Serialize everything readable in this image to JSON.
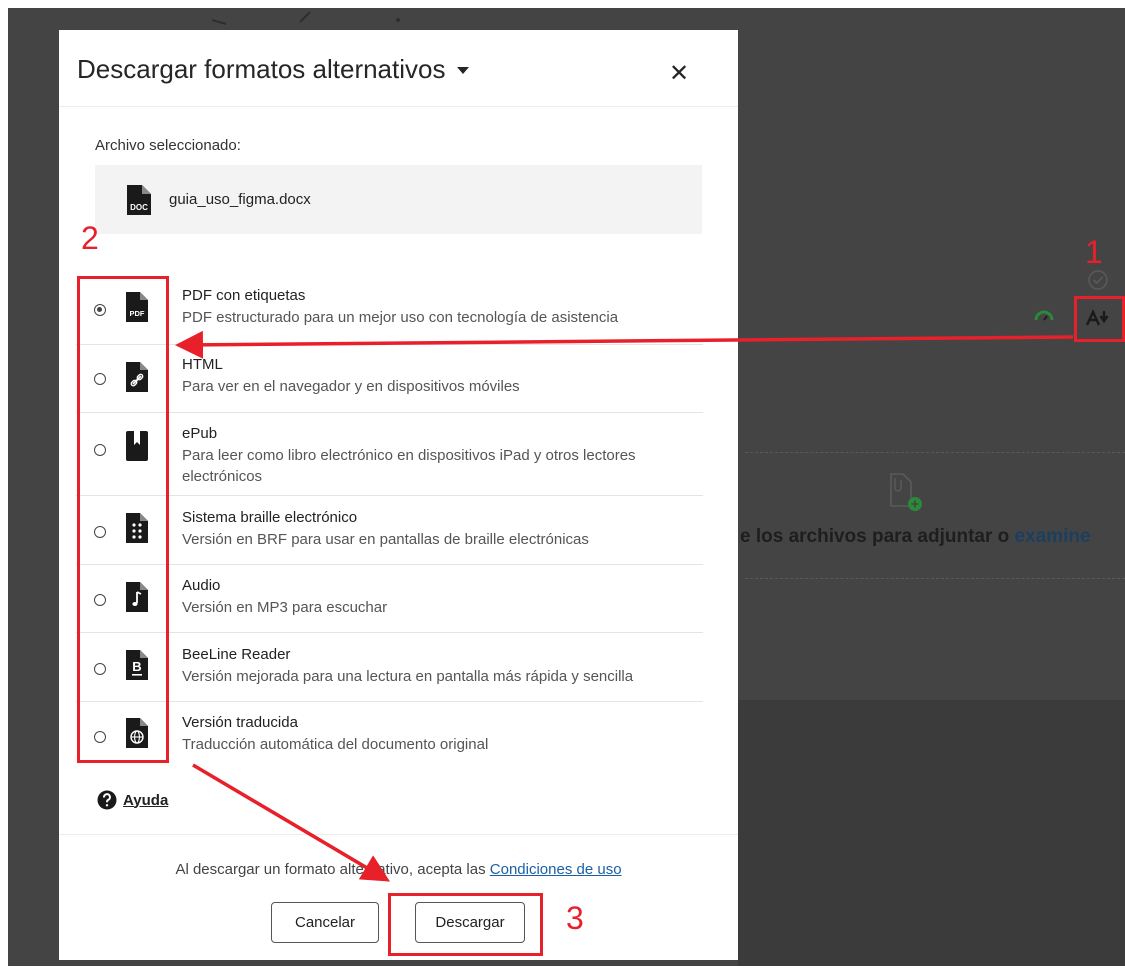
{
  "dialog": {
    "title": "Descargar formatos alternativos",
    "close_label": "✕",
    "selected_file_label": "Archivo seleccionado:",
    "selected_file_name": "guia_uso_figma.docx",
    "file_icon_text": "DOC"
  },
  "options": [
    {
      "title": "PDF con etiquetas",
      "description": "PDF estructurado para un mejor uso con tecnología de asistencia",
      "icon": "pdf-file-icon",
      "icon_text": "PDF",
      "selected": true
    },
    {
      "title": "HTML",
      "description": "Para ver en el navegador y en dispositivos móviles",
      "icon": "html-link-file-icon",
      "selected": false
    },
    {
      "title": "ePub",
      "description": "Para leer como libro electrónico en dispositivos iPad y otros lectores electrónicos",
      "icon": "epub-book-icon",
      "selected": false
    },
    {
      "title": "Sistema braille electrónico",
      "description": "Versión en BRF para usar en pantallas de braille electrónicas",
      "icon": "braille-file-icon",
      "selected": false
    },
    {
      "title": "Audio",
      "description": "Versión en MP3 para escuchar",
      "icon": "audio-file-icon",
      "selected": false
    },
    {
      "title": "BeeLine Reader",
      "description": "Versión mejorada para una lectura en pantalla más rápida y sencilla",
      "icon": "beeline-file-icon",
      "icon_text": "B",
      "selected": false
    },
    {
      "title": "Versión traducida",
      "description": "Traducción automática del documento original",
      "icon": "globe-file-icon",
      "selected": false
    }
  ],
  "help": {
    "label": "Ayuda"
  },
  "footer": {
    "terms_prefix": "Al descargar un formato alternativo, acepta las ",
    "terms_link": "Condiciones de uso",
    "cancel_label": "Cancelar",
    "download_label": "Descargar"
  },
  "background": {
    "drop_text": "e los archivos para adjuntar o ",
    "drop_link": "examine"
  },
  "annotations": {
    "step1": "1",
    "step2": "2",
    "step3": "3",
    "color": "#e8202a"
  },
  "colors": {
    "backdrop": "#444444",
    "link": "#1a5fa8",
    "gauge": "#2a8a3a"
  }
}
